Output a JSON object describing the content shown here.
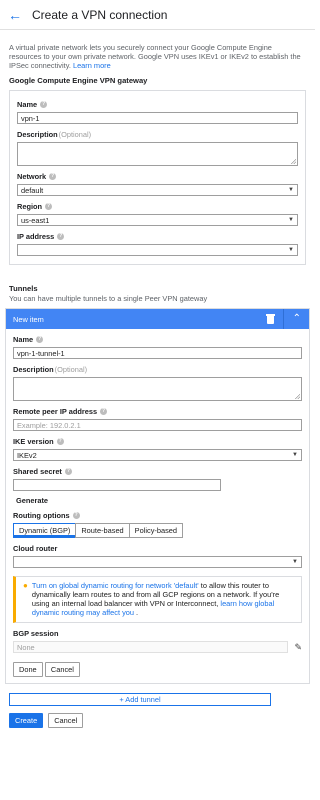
{
  "header": {
    "back_icon": "arrow-left-icon",
    "title": "Create a VPN connection"
  },
  "intro": {
    "text": "A virtual private network lets you securely connect your Google Compute Engine resources to your own private network. Google VPN uses IKEv1 or IKEv2 to establish the IPSec connectivity.",
    "link": "Learn more"
  },
  "gateway": {
    "title": "Google Compute Engine VPN gateway",
    "name_label": "Name",
    "name_value": "vpn-1",
    "description_label": "Description",
    "description_optional": "(Optional)",
    "network_label": "Network",
    "network_value": "default",
    "region_label": "Region",
    "region_value": "us-east1",
    "ip_label": "IP address",
    "ip_value": ""
  },
  "tunnels": {
    "title": "Tunnels",
    "subtitle": "You can have multiple tunnels to a single Peer VPN gateway",
    "item": {
      "header": "New item",
      "header_color": "#4285f4",
      "name_label": "Name",
      "name_value": "vpn-1-tunnel-1",
      "description_label": "Description",
      "description_optional": "(Optional)",
      "remote_ip_label": "Remote peer IP address",
      "remote_ip_placeholder": "Example: 192.0.2.1",
      "ike_label": "IKE version",
      "ike_value": "IKEv2",
      "secret_label": "Shared secret",
      "secret_value": "",
      "generate_label": "Generate",
      "routing_label": "Routing options",
      "routing_options": [
        "Dynamic (BGP)",
        "Route-based",
        "Policy-based"
      ],
      "routing_selected": "Dynamic (BGP)",
      "cloud_router_label": "Cloud router",
      "cloud_router_value": "",
      "notice": {
        "icon": "lightbulb-icon",
        "link1": "Turn on global dynamic routing for network 'default'",
        "text": " to allow this router to dynamically learn routes to and from all GCP regions on a network. If you're using an internal load balancer with VPN or Interconnect, ",
        "link2": "learn how global dynamic routing may affect you",
        "end": " ."
      },
      "bgp_label": "BGP session",
      "bgp_value": "None",
      "done_label": "Done",
      "cancel_label": "Cancel"
    },
    "add_label": "+ Add tunnel"
  },
  "footer": {
    "create_label": "Create",
    "cancel_label": "Cancel"
  },
  "colors": {
    "primary": "#1a73e8",
    "warning": "#f9ab00"
  }
}
